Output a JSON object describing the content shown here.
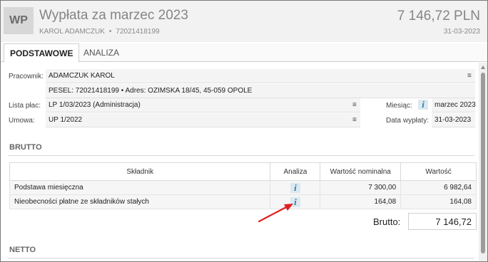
{
  "header": {
    "badge": "WP",
    "title": "Wypłata za marzec 2023",
    "employee_name": "KAROL ADAMCZUK",
    "separator": "•",
    "employee_id": "72021418199",
    "amount": "7 146,72 PLN",
    "date": "31-03-2023"
  },
  "tabs": [
    {
      "label": "PODSTAWOWE",
      "active": true
    },
    {
      "label": "ANALIZA",
      "active": false
    }
  ],
  "form": {
    "employee_label": "Pracownik:",
    "employee_value": "ADAMCZUK KAROL",
    "pesel_line": "PESEL: 72021418199  •  Adres:  OZIMSKA 18/45, 45-059 OPOLE",
    "payroll_label": "Lista płac:",
    "payroll_value": "LP 1/03/2023 (Administracja)",
    "contract_label": "Umowa:",
    "contract_value": "UP 1/2022",
    "month_label": "Miesiąc:",
    "month_value": "marzec 2023",
    "paydate_label": "Data wypłaty:",
    "paydate_value": "31-03-2023",
    "menu_glyph": "≡",
    "info_glyph": "i"
  },
  "sections": {
    "brutto": "BRUTTO",
    "netto": "NETTO"
  },
  "table": {
    "columns": [
      "Składnik",
      "Analiza",
      "Wartość nominalna",
      "Wartość"
    ],
    "rows": [
      {
        "name": "Podstawa miesięczna",
        "nominal": "7 300,00",
        "value": "6 982,64"
      },
      {
        "name": "Nieobecności płatne ze składników stałych",
        "nominal": "164,08",
        "value": "164,08"
      }
    ]
  },
  "summary": {
    "brutto_label": "Brutto:",
    "brutto_value": "7 146,72"
  },
  "colors": {
    "accent_info": "#1e7fbd",
    "annotation_arrow": "#e02020"
  }
}
